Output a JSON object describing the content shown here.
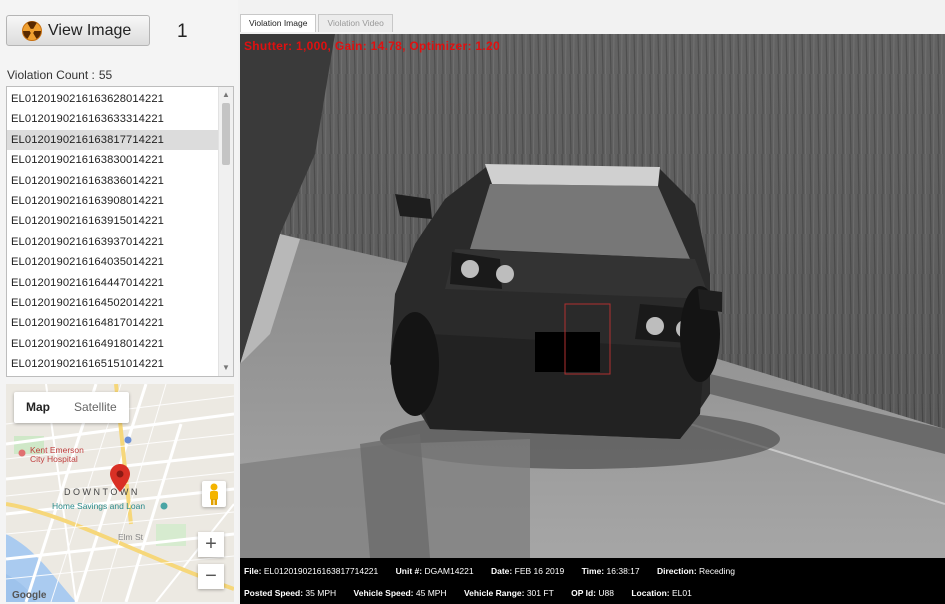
{
  "left": {
    "view_image_label": "View Image",
    "image_number": "1",
    "violation_count_label": "Violation Count :",
    "violation_count": "55",
    "violations": [
      "EL0120190216163628014221",
      "EL0120190216163633314221",
      "EL0120190216163817714221",
      "EL0120190216163830014221",
      "EL0120190216163836014221",
      "EL0120190216163908014221",
      "EL0120190216163915014221",
      "EL0120190216163937014221",
      "EL0120190216164035014221",
      "EL0120190216164447014221",
      "EL0120190216164502014221",
      "EL0120190216164817014221",
      "EL0120190216164918014221",
      "EL0120190216165151014221"
    ],
    "selected_index": 2
  },
  "map": {
    "tab_map": "Map",
    "tab_satellite": "Satellite",
    "label_downtown": "DOWNTOWN",
    "label_hospital": "Kent Emerson City Hospital",
    "label_bank": "Home Savings and Loan",
    "label_street": "Elm St",
    "zoom_in": "+",
    "zoom_out": "−",
    "google": "Google"
  },
  "tabs": {
    "image": "Violation Image",
    "video": "Violation Video"
  },
  "overlay": "Shutter: 1,000, Gain: 14.78, Optimizer: 1.20",
  "info": {
    "file_label": "File:",
    "file": "EL0120190216163817714221",
    "unit_label": "Unit #:",
    "unit": "DGAM14221",
    "date_label": "Date:",
    "date": "FEB 16 2019",
    "time_label": "Time:",
    "time": "16:38:17",
    "direction_label": "Direction:",
    "direction": "Receding",
    "posted_label": "Posted Speed:",
    "posted": "35 MPH",
    "vspeed_label": "Vehicle Speed:",
    "vspeed": "45 MPH",
    "range_label": "Vehicle Range:",
    "range": "301 FT",
    "op_label": "OP Id:",
    "op": "U88",
    "location_label": "Location:",
    "location": "EL01"
  },
  "colors": {
    "overlay_red": "#e01010",
    "selected_row": "#dcdcdc",
    "map_pin": "#d93025"
  },
  "icons": {
    "view_button": "radiation-icon",
    "map_pin": "map-pin-icon",
    "pegman": "pegman-icon"
  }
}
